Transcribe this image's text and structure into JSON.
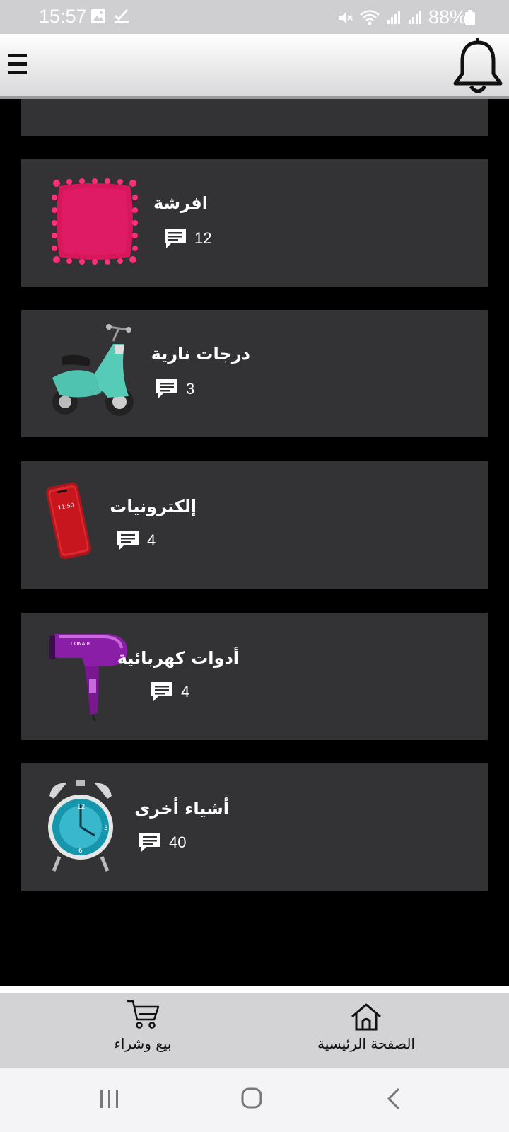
{
  "status_bar": {
    "time": "15:57",
    "battery": "88%",
    "icons": [
      "image-icon",
      "check-icon",
      "mute-icon",
      "wifi-icon",
      "signal-icon",
      "signal-icon",
      "battery-icon"
    ]
  },
  "header": {
    "menu_icon": "hamburger-icon",
    "notification_icon": "bell-icon"
  },
  "categories": [
    {
      "title": "افرشة",
      "count": "12",
      "image": "pink-pillow"
    },
    {
      "title": "درجات نارية",
      "count": "3",
      "image": "teal-scooter"
    },
    {
      "title": "إلكترونيات",
      "count": "4",
      "image": "red-phone"
    },
    {
      "title": "أدوات كهربائية",
      "count": "4",
      "image": "purple-hair-dryer"
    },
    {
      "title": "أشياء أخرى",
      "count": "40",
      "image": "alarm-clock"
    }
  ],
  "bottom_nav": {
    "buy_sell": "بيع وشراء",
    "home": "الصفحة الرئيسية"
  },
  "colors": {
    "background": "#000000",
    "card": "#333335",
    "header": "#e6e6e8",
    "bottom_nav": "#d3d3d5"
  }
}
